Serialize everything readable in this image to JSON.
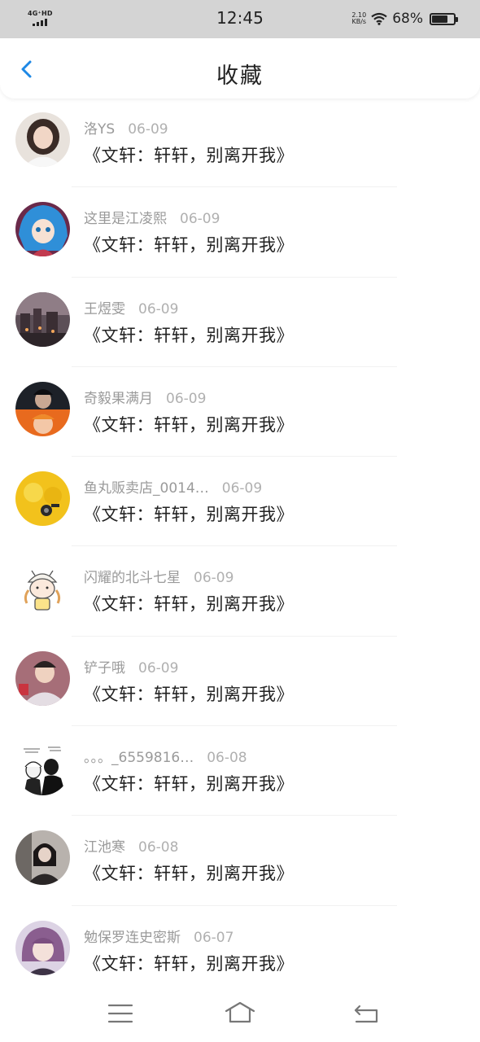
{
  "status": {
    "network": "4G⁺HD",
    "time": "12:45",
    "speed_value": "2.10",
    "speed_unit": "KB/s",
    "battery": "68%"
  },
  "header": {
    "title": "收藏",
    "back_icon": "chevron-left-icon",
    "accent": "#1e88e5"
  },
  "items": [
    {
      "user": "洛YS",
      "date": "06-09",
      "title": "《文轩：轩轩，别离开我》",
      "avatar": "avatar-girl-photo"
    },
    {
      "user": "这里是江凌熙",
      "date": "06-09",
      "title": "《文轩：轩轩，别离开我》",
      "avatar": "avatar-anime-blue-hair"
    },
    {
      "user": "王煜雯",
      "date": "06-09",
      "title": "《文轩：轩轩，别离开我》",
      "avatar": "avatar-night-city"
    },
    {
      "user": "奇毅果满月",
      "date": "06-09",
      "title": "《文轩：轩轩，别离开我》",
      "avatar": "avatar-split-portrait"
    },
    {
      "user": "鱼丸贩卖店_0014…",
      "date": "06-09",
      "title": "《文轩：轩轩，别离开我》",
      "avatar": "avatar-yellow-chick"
    },
    {
      "user": "闪耀的北斗七星",
      "date": "06-09",
      "title": "《文轩：轩轩，别离开我》",
      "avatar": "avatar-cartoon-girl"
    },
    {
      "user": "铲子哦",
      "date": "06-09",
      "title": "《文轩：轩轩，别离开我》",
      "avatar": "avatar-boy-photo"
    },
    {
      "user": "。。。_6559816…",
      "date": "06-08",
      "title": "《文轩：轩轩，别离开我》",
      "avatar": "avatar-manga-sketch"
    },
    {
      "user": "江池寒",
      "date": "06-08",
      "title": "《文轩：轩轩，别离开我》",
      "avatar": "avatar-dark-portrait"
    },
    {
      "user": "勉保罗连史密斯",
      "date": "06-07",
      "title": "《文轩：轩轩，别离开我》",
      "avatar": "avatar-purple-hair"
    }
  ],
  "navbar": {
    "menu_icon": "menu-icon",
    "home_icon": "home-icon",
    "back_icon": "back-arrow-icon"
  }
}
